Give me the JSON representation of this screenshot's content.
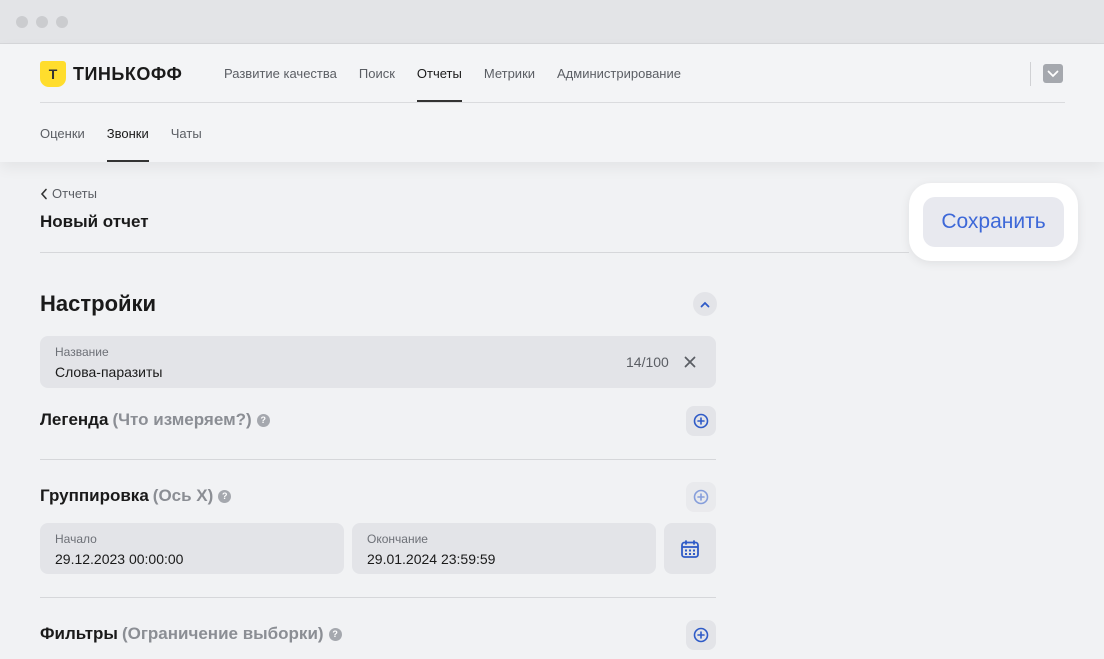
{
  "brand": {
    "logo_mark": "Т",
    "name": "ТИНЬКОФФ",
    "accent": "#ffdd2d"
  },
  "topnav": {
    "items": [
      {
        "label": "Развитие качества",
        "active": false
      },
      {
        "label": "Поиск",
        "active": false
      },
      {
        "label": "Отчеты",
        "active": true
      },
      {
        "label": "Метрики",
        "active": false
      },
      {
        "label": "Администрирование",
        "active": false
      }
    ]
  },
  "subnav": {
    "items": [
      {
        "label": "Оценки",
        "active": false
      },
      {
        "label": "Звонки",
        "active": true
      },
      {
        "label": "Чаты",
        "active": false
      }
    ]
  },
  "page": {
    "back_label": "Отчеты",
    "title": "Новый отчет",
    "save_label": "Сохранить",
    "save_color": "#3d68d8"
  },
  "settings": {
    "title": "Настройки",
    "name_field": {
      "label": "Название",
      "value": "Слова-паразиты",
      "counter": "14/100"
    },
    "legend": {
      "title": "Легенда",
      "hint": "(Что измеряем?)"
    },
    "grouping": {
      "title": "Группировка",
      "hint": "(Ось X)",
      "start": {
        "label": "Начало",
        "value": "29.12.2023 00:00:00"
      },
      "end": {
        "label": "Окончание",
        "value": "29.01.2024 23:59:59"
      }
    },
    "filters": {
      "title": "Фильтры",
      "hint": "(Ограничение выборки)"
    }
  },
  "icons": {
    "help": "question-icon",
    "add": "plus-circle-icon",
    "calendar": "calendar-icon",
    "clear": "close-icon",
    "collapse": "chevron-up-icon"
  }
}
